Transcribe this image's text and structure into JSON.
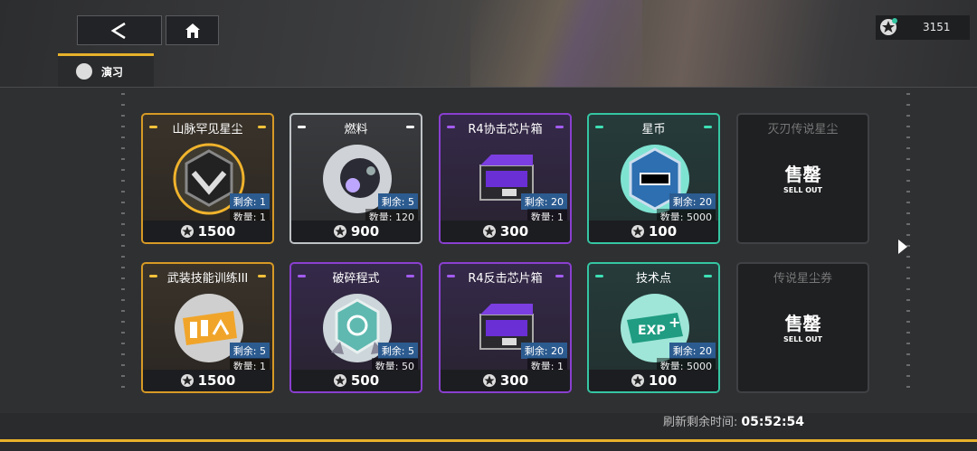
{
  "header": {
    "currency_amount": "3151"
  },
  "tab": {
    "label": "演习"
  },
  "shop": {
    "items": [
      {
        "title": "山脉罕见星尘",
        "remain": "剩余: 1",
        "qty": "数量: 1",
        "price": "1500"
      },
      {
        "title": "燃料",
        "remain": "剩余: 5",
        "qty": "数量: 120",
        "price": "900"
      },
      {
        "title": "R4协击芯片箱",
        "remain": "剩余: 20",
        "qty": "数量: 1",
        "price": "300"
      },
      {
        "title": "星币",
        "remain": "剩余: 20",
        "qty": "数量: 5000",
        "price": "100"
      },
      {
        "title": "灭刃传说星尘",
        "sold_big": "售罄",
        "sold_small": "SELL OUT"
      },
      {
        "title": "武装技能训练III",
        "remain": "剩余: 5",
        "qty": "数量: 1",
        "price": "1500"
      },
      {
        "title": "破碎程式",
        "remain": "剩余: 5",
        "qty": "数量: 50",
        "price": "500"
      },
      {
        "title": "R4反击芯片箱",
        "remain": "剩余: 20",
        "qty": "数量: 1",
        "price": "300"
      },
      {
        "title": "技术点",
        "remain": "剩余: 20",
        "qty": "数量: 5000",
        "price": "100"
      },
      {
        "title": "传说星尘券",
        "sold_big": "售罄",
        "sold_small": "SELL OUT"
      }
    ]
  },
  "footer": {
    "refresh_label": "刷新剩余时间:",
    "refresh_time": "05:52:54"
  },
  "colors": {
    "accent": "#e7b12a",
    "gold": "#d79a25",
    "purple": "#8a3fd0",
    "teal": "#35c6a3",
    "white": "#bfc3c6"
  },
  "icons": [
    "back-arrow-icon",
    "home-icon",
    "star-coin-icon",
    "refresh-icon",
    "chevron-right-icon"
  ]
}
